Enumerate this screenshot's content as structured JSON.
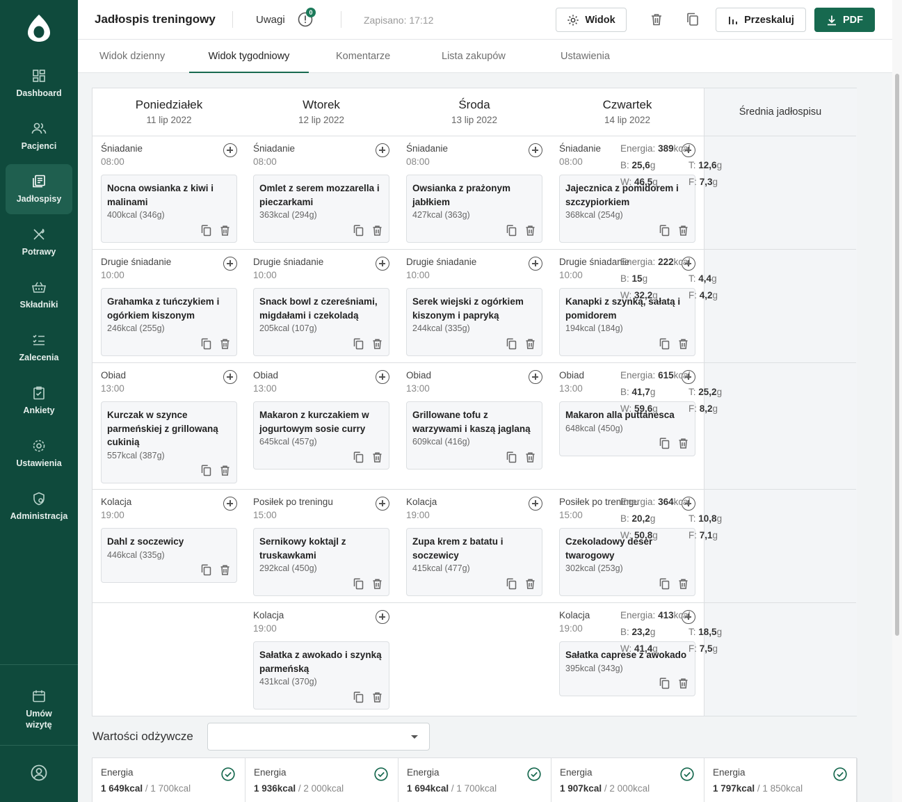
{
  "colors": {
    "sidebar": "#0f4a3c",
    "accent": "#17694f",
    "active_nav": "#1f5f4f"
  },
  "sidebar": {
    "items": [
      {
        "label": "Dashboard",
        "icon": "dashboard-icon"
      },
      {
        "label": "Pacjenci",
        "icon": "patients-icon"
      },
      {
        "label": "Jadłospisy",
        "icon": "meal-plans-icon"
      },
      {
        "label": "Potrawy",
        "icon": "dishes-icon"
      },
      {
        "label": "Składniki",
        "icon": "ingredients-icon"
      },
      {
        "label": "Zalecenia",
        "icon": "recommendations-icon"
      },
      {
        "label": "Ankiety",
        "icon": "surveys-icon"
      },
      {
        "label": "Ustawienia",
        "icon": "settings-icon"
      },
      {
        "label": "Administracja",
        "icon": "admin-icon"
      }
    ],
    "active_index": 2,
    "appointment_label_1": "Umów",
    "appointment_label_2": "wizytę"
  },
  "header": {
    "title": "Jadłospis treningowy",
    "notes_label": "Uwagi",
    "notes_count": "0",
    "saved": "Zapisano: 17:12",
    "view_label": "Widok",
    "rescale_label": "Przeskaluj",
    "pdf_label": "PDF"
  },
  "tabs": [
    "Widok dzienny",
    "Widok tygodniowy",
    "Komentarze",
    "Lista zakupów",
    "Ustawienia"
  ],
  "active_tab": 1,
  "days": [
    {
      "name": "Poniedziałek",
      "date": "11 lip 2022"
    },
    {
      "name": "Wtorek",
      "date": "12 lip 2022"
    },
    {
      "name": "Środa",
      "date": "13 lip 2022"
    },
    {
      "name": "Czwartek",
      "date": "14 lip 2022"
    }
  ],
  "average_title": "Średnia jadłospisu",
  "rows": [
    {
      "meals": [
        {
          "name": "Śniadanie",
          "time": "08:00",
          "dish_lines": [
            "Nocna owsianka z kiwi i",
            "malinami"
          ],
          "kcal": "400kcal (346g)"
        },
        {
          "name": "Śniadanie",
          "time": "08:00",
          "dish_lines": [
            "Omlet z serem mozzarella i",
            "pieczarkami"
          ],
          "kcal": "363kcal (294g)"
        },
        {
          "name": "Śniadanie",
          "time": "08:00",
          "dish_lines": [
            "Owsianka z prażonym",
            "jabłkiem"
          ],
          "kcal": "427kcal (363g)"
        },
        {
          "name": "Śniadanie",
          "time": "08:00",
          "dish_lines": [
            "Jajecznica z pomidorem i",
            "szczypiorkiem"
          ],
          "kcal": "368kcal (254g)"
        }
      ],
      "avg": {
        "energy": "389",
        "b": "25,6",
        "t": "12,6",
        "w": "46,5",
        "f": "7,3"
      }
    },
    {
      "meals": [
        {
          "name": "Drugie śniadanie",
          "time": "10:00",
          "dish_lines": [
            "Grahamka z tuńczykiem i",
            "ogórkiem kiszonym"
          ],
          "kcal": "246kcal (255g)"
        },
        {
          "name": "Drugie śniadanie",
          "time": "10:00",
          "dish_lines": [
            "Snack bowl z czereśniami,",
            "migdałami i czekoladą"
          ],
          "kcal": "205kcal (107g)"
        },
        {
          "name": "Drugie śniadanie",
          "time": "10:00",
          "dish_lines": [
            "Serek wiejski z ogórkiem",
            "kiszonym i papryką"
          ],
          "kcal": "244kcal (335g)"
        },
        {
          "name": "Drugie śniadanie",
          "time": "10:00",
          "dish_lines": [
            "Kanapki z szynką, sałatą i",
            "pomidorem"
          ],
          "kcal": "194kcal (184g)"
        }
      ],
      "avg": {
        "energy": "222",
        "b": "15",
        "t": "4,4",
        "w": "32,2",
        "f": "4,2"
      }
    },
    {
      "meals": [
        {
          "name": "Obiad",
          "time": "13:00",
          "dish_lines": [
            "Kurczak w szynce",
            "parmeńskiej z grillowaną",
            "cukinią"
          ],
          "kcal": "557kcal (387g)"
        },
        {
          "name": "Obiad",
          "time": "13:00",
          "dish_lines": [
            "Makaron z kurczakiem w",
            "jogurtowym sosie curry"
          ],
          "kcal": "645kcal (457g)"
        },
        {
          "name": "Obiad",
          "time": "13:00",
          "dish_lines": [
            "Grillowane tofu z",
            "warzywami i kaszą jaglaną"
          ],
          "kcal": "609kcal (416g)"
        },
        {
          "name": "Obiad",
          "time": "13:00",
          "dish_lines": [
            "Makaron alla puttanesca"
          ],
          "kcal": "648kcal (450g)"
        }
      ],
      "avg": {
        "energy": "615",
        "b": "41,7",
        "t": "25,2",
        "w": "59,6",
        "f": "8,2"
      }
    },
    {
      "meals": [
        {
          "name": "Kolacja",
          "time": "19:00",
          "dish_lines": [
            "Dahl z soczewicy"
          ],
          "kcal": "446kcal (335g)"
        },
        {
          "name": "Posiłek po treningu",
          "time": "15:00",
          "dish_lines": [
            "Sernikowy koktajl z",
            "truskawkami"
          ],
          "kcal": "292kcal (450g)"
        },
        {
          "name": "Kolacja",
          "time": "19:00",
          "dish_lines": [
            "Zupa krem z batatu i",
            "soczewicy"
          ],
          "kcal": "415kcal (477g)"
        },
        {
          "name": "Posiłek po treningu",
          "time": "15:00",
          "dish_lines": [
            "Czekoladowy deser",
            "twarogowy"
          ],
          "kcal": "302kcal (253g)"
        }
      ],
      "avg": {
        "energy": "364",
        "b": "20,2",
        "t": "10,8",
        "w": "50,8",
        "f": "7,1"
      }
    },
    {
      "meals": [
        null,
        {
          "name": "Kolacja",
          "time": "19:00",
          "dish_lines": [
            "Sałatka z awokado i szynką",
            "parmeńską"
          ],
          "kcal": "431kcal (370g)"
        },
        null,
        {
          "name": "Kolacja",
          "time": "19:00",
          "dish_lines": [
            "Sałatka caprese z awokado"
          ],
          "kcal": "395kcal (343g)"
        }
      ],
      "avg": {
        "energy": "413",
        "b": "23,2",
        "t": "18,5",
        "w": "41,4",
        "f": "7,5"
      }
    }
  ],
  "labels": {
    "energy": "Energia:",
    "b": "B:",
    "t": "T:",
    "w": "W:",
    "f": "F:",
    "kcal": "kcal",
    "g": "g"
  },
  "nutrition": {
    "title": "Wartości odżywcze",
    "select_value": "",
    "cells": [
      {
        "label": "Energia",
        "value": "1 649",
        "target": "1 700kcal"
      },
      {
        "label": "Energia",
        "value": "1 936",
        "target": "2 000kcal"
      },
      {
        "label": "Energia",
        "value": "1 694",
        "target": "1 700kcal"
      },
      {
        "label": "Energia",
        "value": "1 907",
        "target": "2 000kcal"
      },
      {
        "label": "Energia",
        "value": "1 797",
        "target": "1 850kcal"
      }
    ]
  }
}
